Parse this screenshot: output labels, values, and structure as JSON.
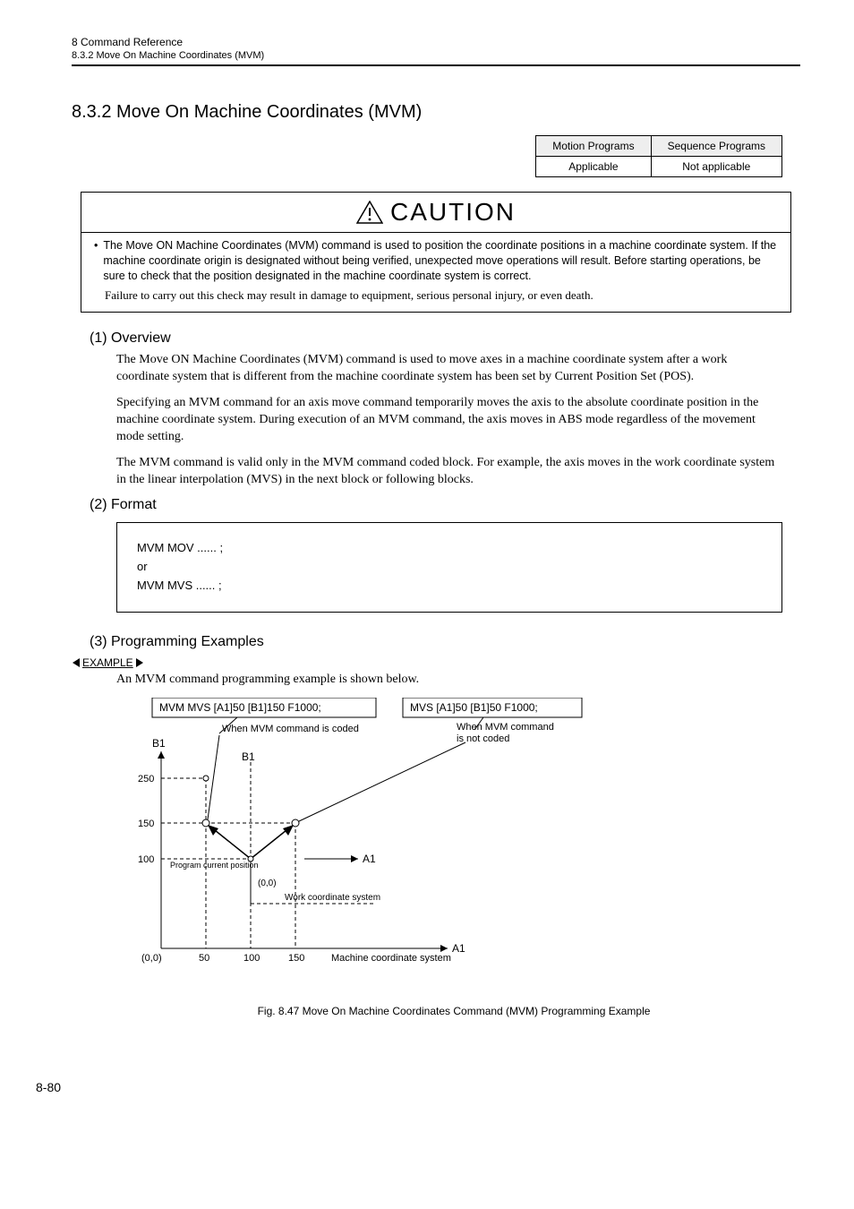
{
  "header": {
    "chapter": "8  Command Reference",
    "section_ref": "8.3.2  Move On Machine Coordinates (MVM)"
  },
  "section": {
    "number_title": "8.3.2  Move On Machine Coordinates (MVM)"
  },
  "applicability": {
    "col1": "Motion Programs",
    "col2": "Sequence Programs",
    "val1": "Applicable",
    "val2": "Not applicable"
  },
  "caution": {
    "label": "CAUTION",
    "bullet": "The Move ON Machine Coordinates (MVM) command is used to position the coordinate positions in a machine coordinate system. If the machine coordinate origin is designated without being verified, unexpected move operations will result. Before starting operations, be sure to check that the position designated in the machine coordinate system is correct.",
    "note": "Failure to carry out this check may result in damage to equipment, serious personal injury, or even death."
  },
  "overview": {
    "heading": "(1) Overview",
    "p1": "The Move ON Machine Coordinates (MVM) command is used to move axes in a machine coordinate system after a work coordinate system that is different from the machine coordinate system has been set by Current Position Set (POS).",
    "p2": "Specifying an MVM command for an axis move command temporarily moves the axis to the absolute coordinate position in the machine coordinate system. During execution of an MVM command, the axis moves in ABS mode regardless of the movement mode setting.",
    "p3": "The MVM command is valid only in the MVM command coded block. For example, the axis moves in the work coordinate system in the linear interpolation (MVS) in the next block or following blocks."
  },
  "format": {
    "heading": "(2) Format",
    "line1": "MVM  MOV ...... ;",
    "line2": "or",
    "line3": "MVM  MVS ...... ;"
  },
  "examples": {
    "heading": "(3) Programming Examples",
    "label": "EXAMPLE",
    "intro": "An MVM command programming example is shown below.",
    "box_left": "MVM  MVS  [A1]50 [B1]150 F1000;",
    "box_right": "MVS [A1]50 [B1]50 F1000;",
    "note_left": "When MVM command is coded",
    "note_right1": "When MVM command",
    "note_right2": "is not coded",
    "axis_b1": "B1",
    "axis_b1_inner": "B1",
    "axis_a1": "A1",
    "axis_a1_top": "A1",
    "tick_250": "250",
    "tick_150": "150",
    "tick_100": "100",
    "tick_50": "50",
    "tick_x100": "100",
    "tick_x150": "150",
    "origin": "(0,0)",
    "origin2": "(0,0)",
    "pcp": "Program current position",
    "wcs": "Work coordinate system",
    "mcs": "Machine coordinate system",
    "caption": "Fig. 8.47  Move On Machine Coordinates Command (MVM) Programming Example"
  },
  "page": "8-80"
}
